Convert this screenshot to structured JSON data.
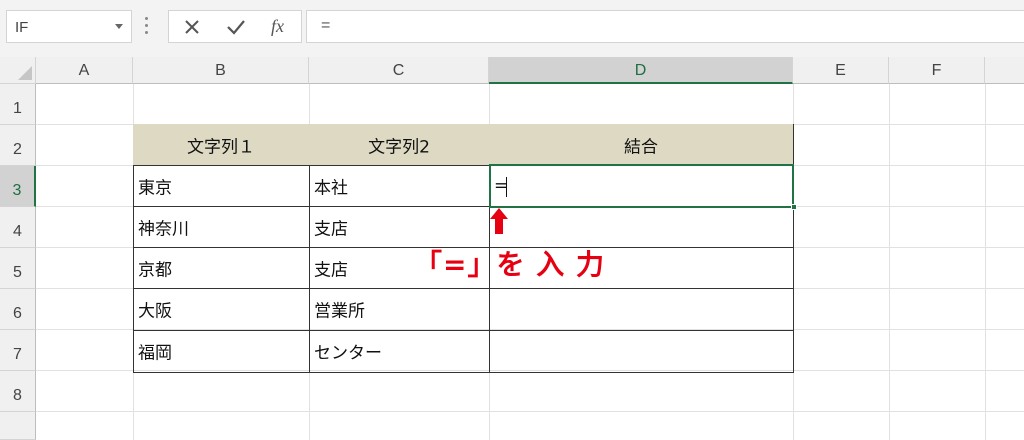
{
  "name_box": {
    "value": "IF"
  },
  "formula_bar": {
    "value": "="
  },
  "toolbar": {
    "cancel_icon": "close-icon",
    "enter_icon": "check-icon",
    "fx_label": "fx"
  },
  "columns": [
    "A",
    "B",
    "C",
    "D",
    "E",
    "F"
  ],
  "rows": [
    "1",
    "2",
    "3",
    "4",
    "5",
    "6",
    "7",
    "8"
  ],
  "table": {
    "headers": [
      "文字列１",
      "文字列2",
      "結合"
    ],
    "rows": [
      [
        "東京",
        "本社",
        ""
      ],
      [
        "神奈川",
        "支店",
        ""
      ],
      [
        "京都",
        "支店",
        ""
      ],
      [
        "大阪",
        "営業所",
        ""
      ],
      [
        "福岡",
        "センター",
        ""
      ]
    ]
  },
  "active_cell": {
    "ref": "D3",
    "value": "="
  },
  "annotation": {
    "text": "「=」を 入 力"
  },
  "colors": {
    "accent": "#217346",
    "header_fill": "#ddd9c3",
    "annotation": "#e60012"
  }
}
